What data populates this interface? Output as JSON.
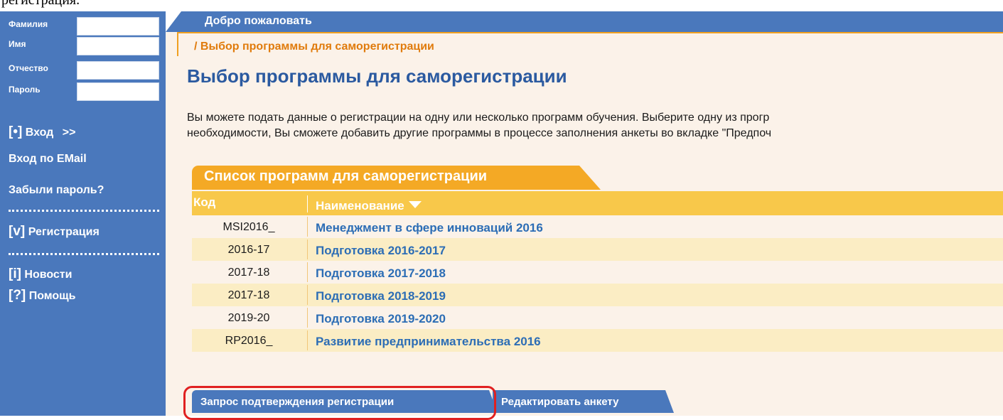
{
  "top_caption": "регистрация.",
  "sidebar": {
    "fields": [
      {
        "label": "Фамилия",
        "value": ""
      },
      {
        "label": "Имя",
        "value": ""
      },
      {
        "label": "Отчество",
        "value": ""
      },
      {
        "label": "Пароль",
        "value": ""
      }
    ],
    "login": {
      "bracket": "[•]",
      "label": "Вход",
      "suffix": ">>"
    },
    "login_email": "Вход по EMail",
    "forgot": "Забыли пароль?",
    "register": {
      "bracket": "[v]",
      "label": "Регистрация"
    },
    "news": {
      "bracket": "[i]",
      "label": "Новости"
    },
    "help": {
      "bracket": "[?]",
      "label": "Помощь"
    }
  },
  "header": {
    "title": "Добро пожаловать"
  },
  "breadcrumb": "/ Выбор программы для саморегистрации",
  "page_title": "Выбор программы для саморегистрации",
  "intro": [
    "Вы можете подать данные о регистрации на одну или несколько программ обучения. Выберите одну из прогр",
    "необходимости, Вы сможете добавить другие программы в процессе заполнения анкеты во вкладке \"Предпоч"
  ],
  "programs_tab": "Список программ для саморегистрации",
  "table": {
    "columns": [
      "Код",
      "Наименование"
    ],
    "rows": [
      {
        "code": "MSI2016_",
        "name": "Менеджмент в сфере инноваций 2016"
      },
      {
        "code": "2016-17",
        "name": "Подготовка 2016-2017"
      },
      {
        "code": "2017-18",
        "name": "Подготовка 2017-2018"
      },
      {
        "code": "2017-18",
        "name": "Подготовка 2018-2019"
      },
      {
        "code": "2019-20",
        "name": "Подготовка 2019-2020"
      },
      {
        "code": "RP2016_",
        "name": "Развитие предпринимательства 2016"
      }
    ]
  },
  "buttons": {
    "confirm": "Запрос подтверждения регистрации",
    "edit": "Редактировать анкету"
  },
  "colors": {
    "sidebar_blue": "#4a78bc",
    "accent_orange": "#f4a925",
    "table_header": "#f8c84a",
    "link_blue": "#2c6db5",
    "highlight_red": "#e02020"
  }
}
